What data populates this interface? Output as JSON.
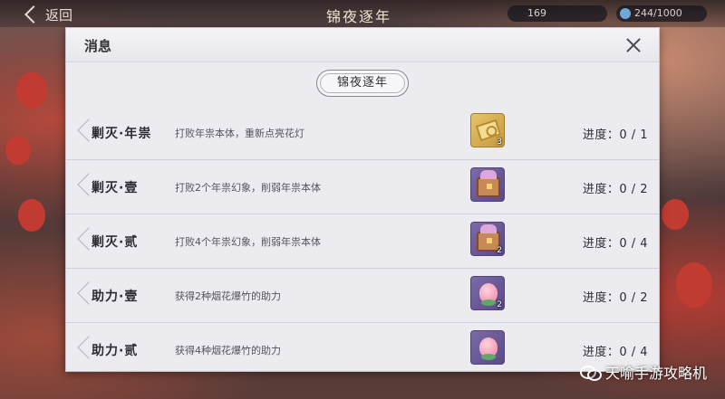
{
  "scene": {
    "back_label": "返回",
    "title": "锦夜逐年",
    "resource_1": "169",
    "resource_2": "244/1000"
  },
  "dialog": {
    "title": "消息",
    "close_icon": "close-icon",
    "section_tab": "锦夜逐年"
  },
  "tasks": [
    {
      "name": "剿灭·年祟",
      "desc": "打败年祟本体，重新点亮花灯",
      "reward_icon": "gold-ticket-icon",
      "reward_count": "3",
      "progress": "进度：0 / 1"
    },
    {
      "name": "剿灭·壹",
      "desc": "打败2个年祟幻象，削弱年祟本体",
      "reward_icon": "treasure-chest-icon",
      "reward_count": "",
      "progress": "进度：0 / 2"
    },
    {
      "name": "剿灭·贰",
      "desc": "打败4个年祟幻象，削弱年祟本体",
      "reward_icon": "treasure-chest-icon",
      "reward_count": "2",
      "progress": "进度：0 / 4"
    },
    {
      "name": "助力·壹",
      "desc": "获得2种烟花爆竹的助力",
      "reward_icon": "peach-icon",
      "reward_count": "2",
      "progress": "进度：0 / 2"
    },
    {
      "name": "助力·贰",
      "desc": "获得4种烟花爆竹的助力",
      "reward_icon": "peach-icon",
      "reward_count": "",
      "progress": "进度：0 / 4"
    }
  ],
  "watermark": "天喻手游攻略机",
  "colors": {
    "dialog_bg": "#ecebf0",
    "text": "#2c2c34",
    "tab_border": "#8a8690"
  }
}
